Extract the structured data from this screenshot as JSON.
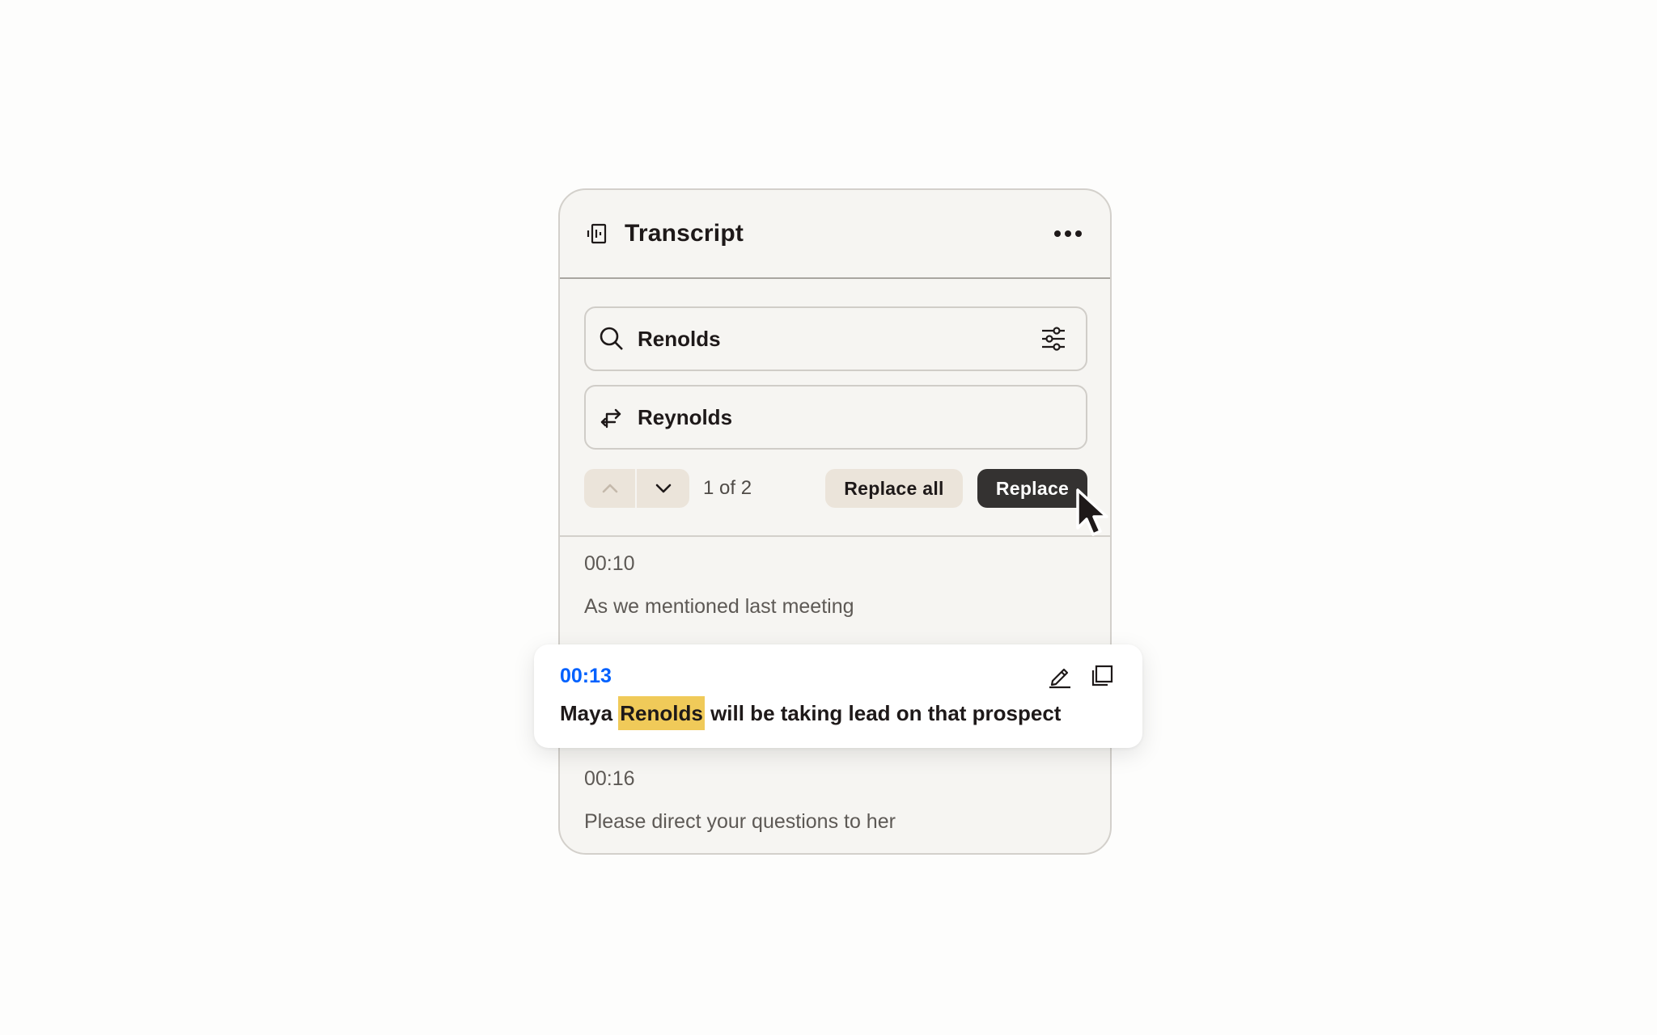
{
  "header": {
    "title": "Transcript",
    "doc_icon": "transcript-icon",
    "more_icon": "more-horizontal-icon"
  },
  "search": {
    "value": "Renolds",
    "icon": "search-icon",
    "filter_icon": "sliders-icon"
  },
  "replace": {
    "value": "Reynolds",
    "icon": "swap-arrows-icon"
  },
  "controls": {
    "counter": "1 of 2",
    "replace_all_label": "Replace all",
    "replace_label": "Replace"
  },
  "entries": [
    {
      "time": "00:10",
      "text": "As we mentioned last meeting"
    },
    {
      "time": "00:13",
      "text_before": "Maya ",
      "match": "Renolds",
      "text_after": " will be taking lead on that prospect",
      "active": true
    },
    {
      "time": "00:16",
      "text": "Please direct your questions to her"
    }
  ],
  "colors": {
    "panel_bg": "#f6f5f2",
    "accent_blue": "#0061fe",
    "highlight": "#f0ca59",
    "primary_button": "#343231",
    "secondary_button": "#ebe4da"
  }
}
